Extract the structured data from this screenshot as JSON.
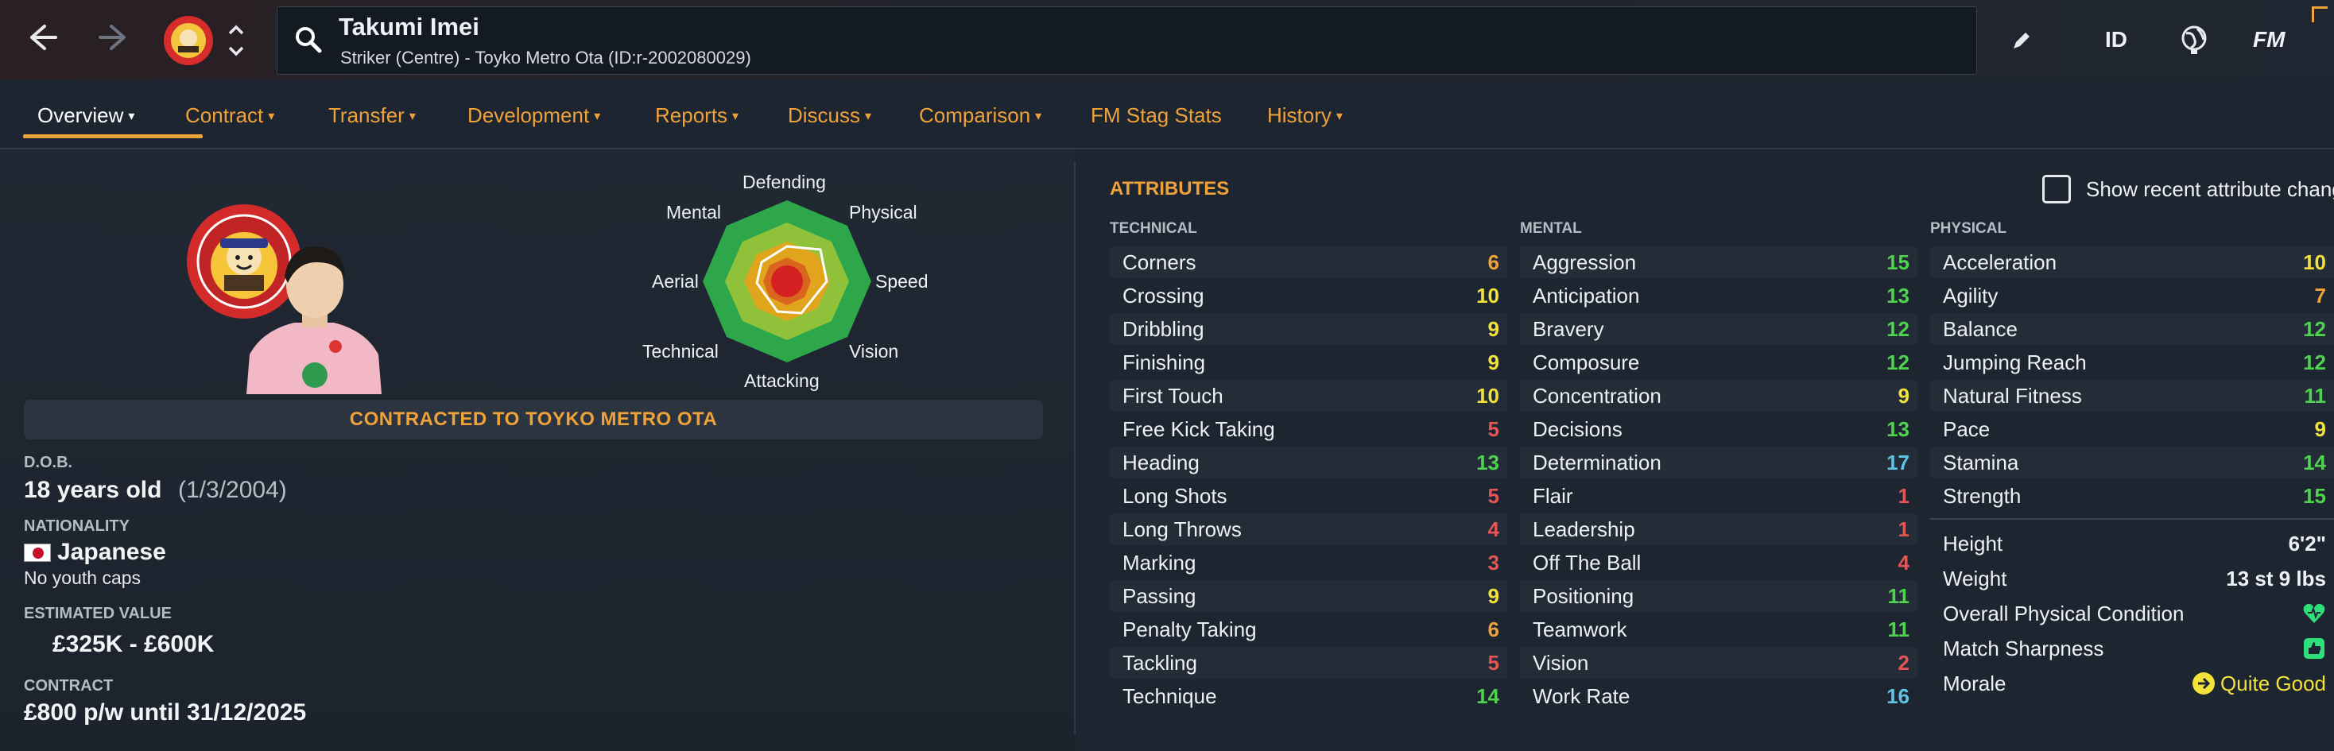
{
  "header": {
    "name": "Takumi Imei",
    "subtitle": "Striker (Centre) - Toyko Metro Ota (ID:r-2002080029)",
    "right_buttons": {
      "id": "ID",
      "fm": "FM"
    }
  },
  "tabs": [
    {
      "label": "Overview",
      "chevron": "▾",
      "active": true
    },
    {
      "label": "Contract",
      "chevron": "▾"
    },
    {
      "label": "Transfer",
      "chevron": "▾"
    },
    {
      "label": "Development",
      "chevron": "▾"
    },
    {
      "label": "Reports",
      "chevron": "▾"
    },
    {
      "label": "Discuss",
      "chevron": "▾"
    },
    {
      "label": "Comparison",
      "chevron": "▾"
    },
    {
      "label": "FM Stag Stats",
      "chevron": ""
    },
    {
      "label": "History",
      "chevron": "▾"
    }
  ],
  "radar": {
    "labels": [
      "Defending",
      "Physical",
      "Speed",
      "Vision",
      "Attacking",
      "Technical",
      "Aerial",
      "Mental"
    ]
  },
  "profile": {
    "contracted_banner": "CONTRACTED TO TOYKO METRO OTA",
    "dob_label": "D.O.B.",
    "age": "18 years old",
    "dob": "(1/3/2004)",
    "nationality_label": "NATIONALITY",
    "nationality": "Japanese",
    "youth_caps": "No youth caps",
    "value_label": "ESTIMATED VALUE",
    "value": "£325K - £600K",
    "contract_label": "CONTRACT",
    "contract": "£800 p/w until 31/12/2025"
  },
  "attributes": {
    "title": "ATTRIBUTES",
    "recent_changes_label": "Show recent attribute changes",
    "technical": {
      "label": "TECHNICAL",
      "items": [
        {
          "name": "Corners",
          "value": "6"
        },
        {
          "name": "Crossing",
          "value": "10"
        },
        {
          "name": "Dribbling",
          "value": "9"
        },
        {
          "name": "Finishing",
          "value": "9"
        },
        {
          "name": "First Touch",
          "value": "10"
        },
        {
          "name": "Free Kick Taking",
          "value": "5"
        },
        {
          "name": "Heading",
          "value": "13"
        },
        {
          "name": "Long Shots",
          "value": "5"
        },
        {
          "name": "Long Throws",
          "value": "4"
        },
        {
          "name": "Marking",
          "value": "3"
        },
        {
          "name": "Passing",
          "value": "9"
        },
        {
          "name": "Penalty Taking",
          "value": "6"
        },
        {
          "name": "Tackling",
          "value": "5"
        },
        {
          "name": "Technique",
          "value": "14"
        }
      ]
    },
    "mental": {
      "label": "MENTAL",
      "items": [
        {
          "name": "Aggression",
          "value": "15"
        },
        {
          "name": "Anticipation",
          "value": "13"
        },
        {
          "name": "Bravery",
          "value": "12"
        },
        {
          "name": "Composure",
          "value": "12"
        },
        {
          "name": "Concentration",
          "value": "9"
        },
        {
          "name": "Decisions",
          "value": "13"
        },
        {
          "name": "Determination",
          "value": "17"
        },
        {
          "name": "Flair",
          "value": "1"
        },
        {
          "name": "Leadership",
          "value": "1"
        },
        {
          "name": "Off The Ball",
          "value": "4"
        },
        {
          "name": "Positioning",
          "value": "11"
        },
        {
          "name": "Teamwork",
          "value": "11"
        },
        {
          "name": "Vision",
          "value": "2"
        },
        {
          "name": "Work Rate",
          "value": "16"
        }
      ]
    },
    "physical": {
      "label": "PHYSICAL",
      "items": [
        {
          "name": "Acceleration",
          "value": "10"
        },
        {
          "name": "Agility",
          "value": "7"
        },
        {
          "name": "Balance",
          "value": "12"
        },
        {
          "name": "Jumping Reach",
          "value": "12"
        },
        {
          "name": "Natural Fitness",
          "value": "11"
        },
        {
          "name": "Pace",
          "value": "9"
        },
        {
          "name": "Stamina",
          "value": "14"
        },
        {
          "name": "Strength",
          "value": "15"
        }
      ]
    },
    "extra": {
      "height_label": "Height",
      "height": "6'2\"",
      "weight_label": "Weight",
      "weight": "13 st 9 lbs",
      "condition_label": "Overall Physical Condition",
      "condition_icon": "heart-icon",
      "sharpness_label": "Match Sharpness",
      "sharpness_icon": "thumb-icon",
      "morale_label": "Morale",
      "morale": "Quite Good",
      "morale_icon": "morale-arrow-icon"
    }
  },
  "colors": {
    "accent": "#f0a23a",
    "red": "#e45555",
    "orange": "#f0a23a",
    "yellow": "#f2e23a",
    "green": "#4fd24f",
    "blue": "#5fc4e4"
  }
}
